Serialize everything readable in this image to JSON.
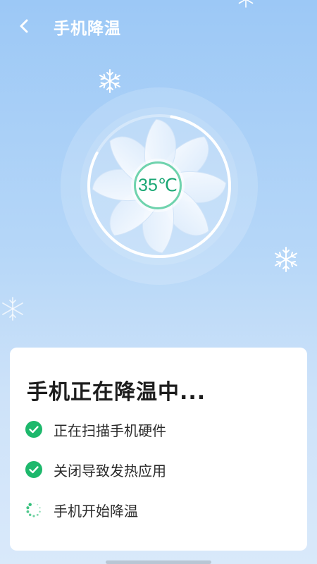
{
  "header": {
    "title": "手机降温",
    "back_icon": "chevron-left-icon"
  },
  "fan": {
    "temperature": "35℃",
    "progress": 0.8,
    "accent_color": "#1aa774"
  },
  "status_card": {
    "heading": "手机正在降温中...",
    "steps": [
      {
        "label": "正在扫描手机硬件",
        "state": "done",
        "icon": "check-circle-icon"
      },
      {
        "label": "关闭导致发热应用",
        "state": "done",
        "icon": "check-circle-icon"
      },
      {
        "label": "手机开始降温",
        "state": "in-progress",
        "icon": "loading-spinner-icon"
      }
    ]
  },
  "colors": {
    "background_top": "#9cc8f6",
    "background_bottom": "#d9e9fa",
    "check_green": "#1db86c"
  }
}
